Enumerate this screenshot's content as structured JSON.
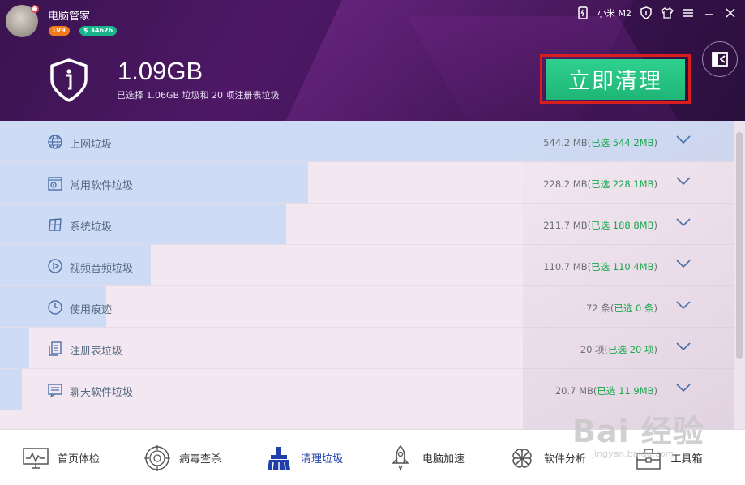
{
  "app": {
    "title": "电脑管家",
    "level": "LV9",
    "coins": "$ 34626"
  },
  "topbar": {
    "phone_label": "小米 M2"
  },
  "summary": {
    "size": "1.09GB",
    "detail": "已选择 1.06GB 垃圾和 20 项注册表垃圾",
    "clean_button": "立即清理"
  },
  "items": [
    {
      "label": "上网垃圾",
      "total": "544.2 MB(",
      "selected": "已选 544.2MB",
      "close": ")",
      "icon": "globe-icon",
      "fill": 1.0
    },
    {
      "label": "常用软件垃圾",
      "total": "228.2 MB(",
      "selected": "已选 228.1MB",
      "close": ")",
      "icon": "software-icon",
      "fill": 0.42
    },
    {
      "label": "系统垃圾",
      "total": "211.7 MB(",
      "selected": "已选 188.8MB",
      "close": ")",
      "icon": "windows-icon",
      "fill": 0.39
    },
    {
      "label": "视频音频垃圾",
      "total": "110.7 MB(",
      "selected": "已选 110.4MB",
      "close": ")",
      "icon": "play-icon",
      "fill": 0.205
    },
    {
      "label": "使用痕迹",
      "total": "72 条(",
      "selected": "已选 0 条",
      "close": ")",
      "icon": "clock-icon",
      "fill": 0.145
    },
    {
      "label": "注册表垃圾",
      "total": "20 项(",
      "selected": "已选 20 项",
      "close": ")",
      "icon": "registry-icon",
      "fill": 0.04
    },
    {
      "label": "聊天软件垃圾",
      "total": "20.7 MB(",
      "selected": "已选 11.9MB",
      "close": ")",
      "icon": "chat-icon",
      "fill": 0.03
    }
  ],
  "nav": [
    {
      "label": "首页体检",
      "icon": "monitor-icon"
    },
    {
      "label": "病毒查杀",
      "icon": "target-icon"
    },
    {
      "label": "清理垃圾",
      "icon": "broom-icon",
      "active": true
    },
    {
      "label": "电脑加速",
      "icon": "rocket-icon"
    },
    {
      "label": "软件分析",
      "icon": "clover-icon"
    },
    {
      "label": "工具箱",
      "icon": "toolbox-icon"
    }
  ],
  "watermark": {
    "main": "Bai 经验",
    "sub": "jingyan.baidu.com"
  },
  "colors": {
    "accent_green": "#1fb676",
    "selected_green": "#15a84b",
    "active_nav": "#1f3faa",
    "highlight_border": "#d81e1e"
  }
}
